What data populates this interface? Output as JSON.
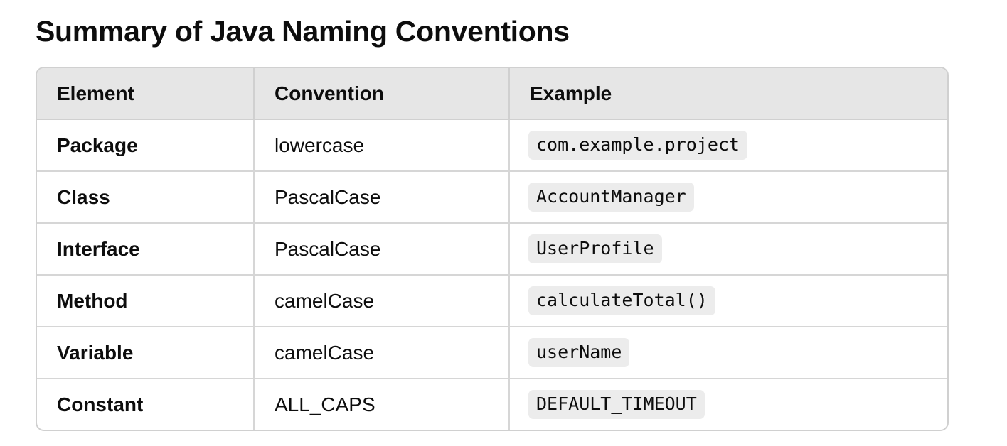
{
  "title": "Summary of Java Naming Conventions",
  "table": {
    "headers": [
      "Element",
      "Convention",
      "Example"
    ],
    "rows": [
      {
        "element": "Package",
        "convention": "lowercase",
        "example": "com.example.project"
      },
      {
        "element": "Class",
        "convention": "PascalCase",
        "example": "AccountManager"
      },
      {
        "element": "Interface",
        "convention": "PascalCase",
        "example": "UserProfile"
      },
      {
        "element": "Method",
        "convention": "camelCase",
        "example": "calculateTotal()"
      },
      {
        "element": "Variable",
        "convention": "camelCase",
        "example": "userName"
      },
      {
        "element": "Constant",
        "convention": "ALL_CAPS",
        "example": "DEFAULT_TIMEOUT"
      }
    ]
  },
  "colors": {
    "text": "#0d0d0d",
    "header_bg": "#e6e6e6",
    "border": "#d0d0d0",
    "code_bg": "#ececec"
  }
}
